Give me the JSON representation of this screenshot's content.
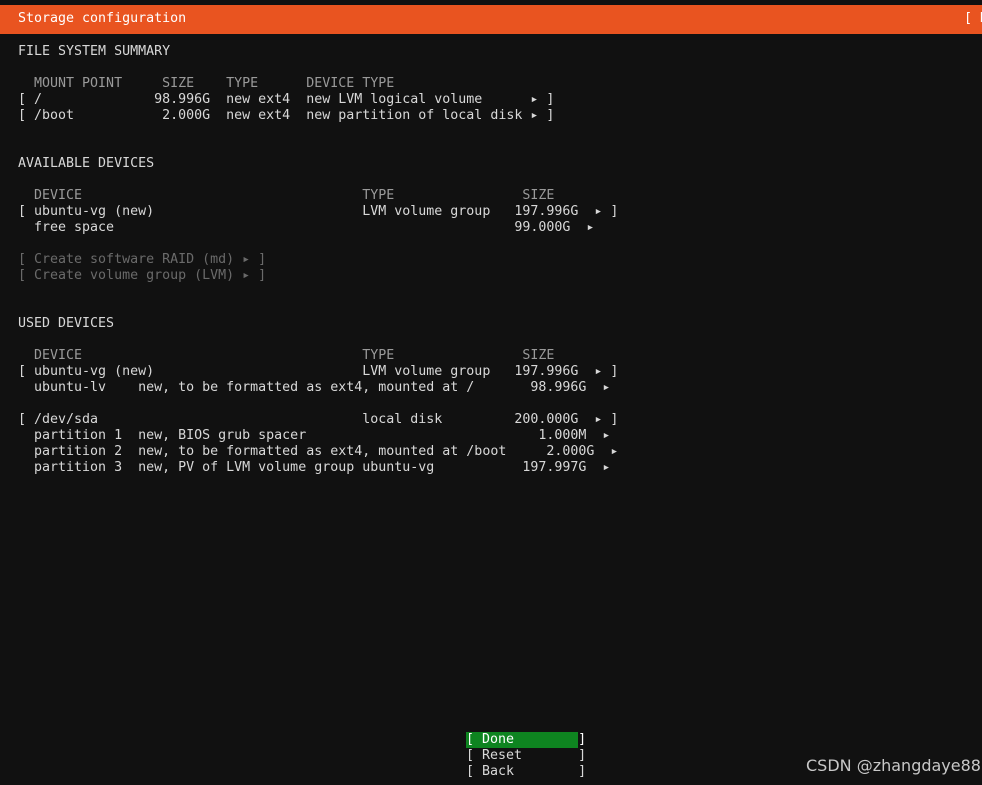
{
  "header": {
    "title": "Storage configuration",
    "help": "[ H"
  },
  "fs_summary": {
    "heading": "FILE SYSTEM SUMMARY",
    "columns_line": "  MOUNT POINT     SIZE    TYPE      DEVICE TYPE",
    "rows": [
      "[ /              98.996G  new ext4  new LVM logical volume      ▸ ]",
      "[ /boot           2.000G  new ext4  new partition of local disk ▸ ]"
    ]
  },
  "available": {
    "heading": "AVAILABLE DEVICES",
    "columns_line": "  DEVICE                                   TYPE                SIZE",
    "rows": [
      "[ ubuntu-vg (new)                          LVM volume group   197.996G  ▸ ]",
      "  free space                                                  99.000G  ▸"
    ],
    "actions": [
      "[ Create software RAID (md) ▸ ]",
      "[ Create volume group (LVM) ▸ ]"
    ]
  },
  "used": {
    "heading": "USED DEVICES",
    "columns_line": "  DEVICE                                   TYPE                SIZE",
    "group1": [
      "[ ubuntu-vg (new)                          LVM volume group   197.996G  ▸ ]",
      "  ubuntu-lv    new, to be formatted as ext4, mounted at /       98.996G  ▸"
    ],
    "group2": [
      "[ /dev/sda                                 local disk         200.000G  ▸ ]",
      "  partition 1  new, BIOS grub spacer                             1.000M  ▸",
      "  partition 2  new, to be formatted as ext4, mounted at /boot     2.000G  ▸",
      "  partition 3  new, PV of LVM volume group ubuntu-vg           197.997G  ▸"
    ]
  },
  "buttons": {
    "done": "[ Done        ]",
    "reset": "[ Reset       ]",
    "back": "[ Back        ]"
  },
  "watermark": "CSDN @zhangdaye88",
  "colors": {
    "header_bg": "#e95420",
    "background": "#111111",
    "focused_button": "#0e8420"
  }
}
